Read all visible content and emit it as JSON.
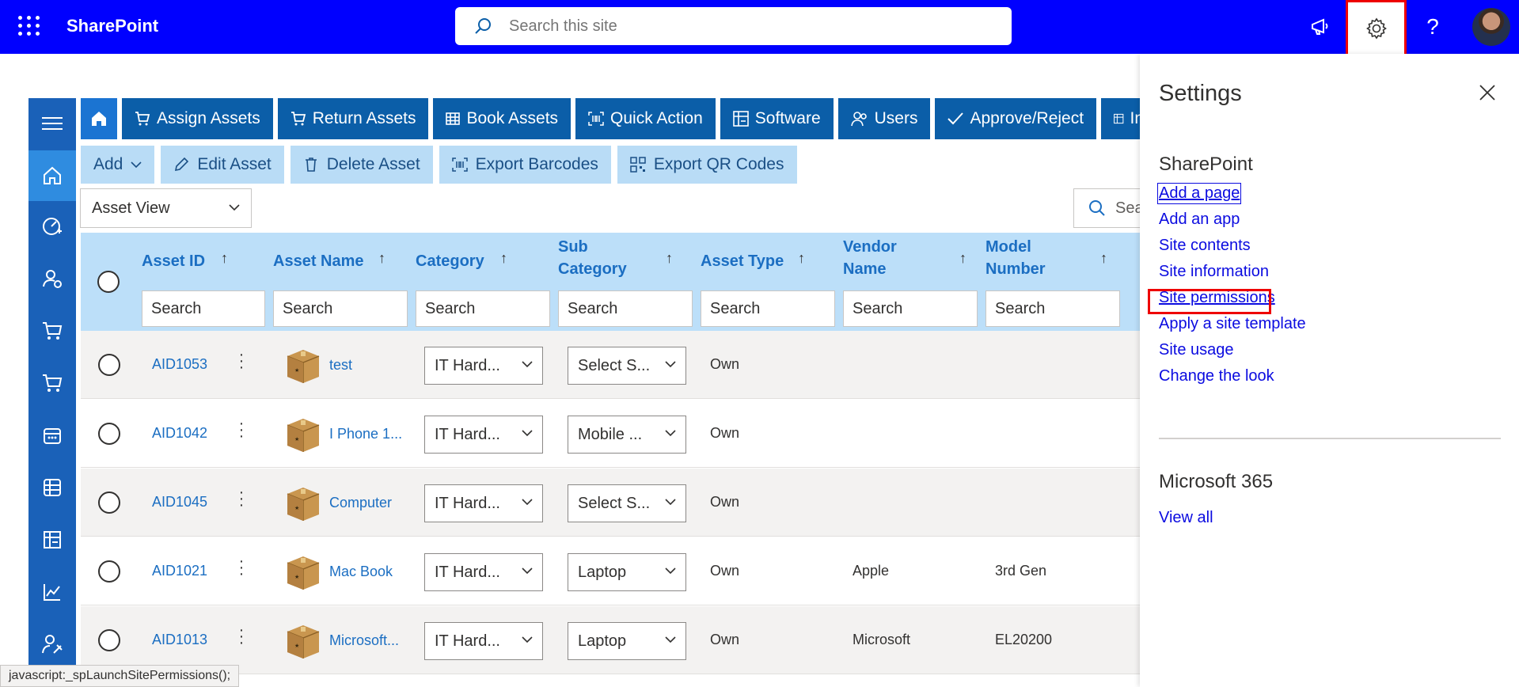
{
  "suite": {
    "brand": "SharePoint",
    "search_placeholder": "Search this site"
  },
  "tabs": [
    {
      "label": "Assign Assets",
      "icon": "cart-icon"
    },
    {
      "label": "Return Assets",
      "icon": "cart-return-icon"
    },
    {
      "label": "Book Assets",
      "icon": "table-icon"
    },
    {
      "label": "Quick Action",
      "icon": "barcode-icon"
    },
    {
      "label": "Software",
      "icon": "software-icon"
    },
    {
      "label": "Users",
      "icon": "users-icon"
    },
    {
      "label": "Approve/Reject",
      "icon": "check-icon"
    },
    {
      "label": "In",
      "icon": "inventory-icon"
    }
  ],
  "actions": {
    "add": "Add",
    "edit": "Edit Asset",
    "delete": "Delete Asset",
    "export_barcodes": "Export Barcodes",
    "export_qr": "Export QR Codes"
  },
  "view_select": "Asset View",
  "grid_search": "Sea",
  "columns": {
    "asset_id": "Asset ID",
    "asset_name": "Asset Name",
    "category": "Category",
    "sub_category_1": "Sub",
    "sub_category_2": "Category",
    "asset_type": "Asset Type",
    "vendor_1": "Vendor",
    "vendor_2": "Name",
    "model_1": "Model",
    "model_2": "Number",
    "search_placeholder": "Search",
    "sort_arrow": "↑"
  },
  "rows": [
    {
      "id": "AID1053",
      "name": "test",
      "category": "IT Hard...",
      "sub": "Select S...",
      "type": "Own",
      "vendor": "",
      "model": ""
    },
    {
      "id": "AID1042",
      "name": "I Phone 1...",
      "category": "IT Hard...",
      "sub": "Mobile ...",
      "type": "Own",
      "vendor": "",
      "model": ""
    },
    {
      "id": "AID1045",
      "name": "Computer",
      "category": "IT Hard...",
      "sub": "Select S...",
      "type": "Own",
      "vendor": "",
      "model": ""
    },
    {
      "id": "AID1021",
      "name": "Mac Book",
      "category": "IT Hard...",
      "sub": "Laptop",
      "type": "Own",
      "vendor": "Apple",
      "model": "3rd Gen"
    },
    {
      "id": "AID1013",
      "name": "Microsoft...",
      "category": "IT Hard...",
      "sub": "Laptop",
      "type": "Own",
      "vendor": "Microsoft",
      "model": "EL20200"
    }
  ],
  "settings": {
    "title": "Settings",
    "section_sharepoint": "SharePoint",
    "links": [
      "Add a page",
      "Add an app",
      "Site contents",
      "Site information",
      "Site permissions",
      "Apply a site template",
      "Site usage",
      "Change the look"
    ],
    "section_m365": "Microsoft 365",
    "view_all": "View all"
  },
  "statusbar": "javascript:_spLaunchSitePermissions();",
  "colors": {
    "suite_bg": "#0000ff",
    "tab_bg": "#0b5ea8",
    "action_bg": "#b9dcf6",
    "link": "#0b0be0",
    "highlight": "#e00000"
  }
}
